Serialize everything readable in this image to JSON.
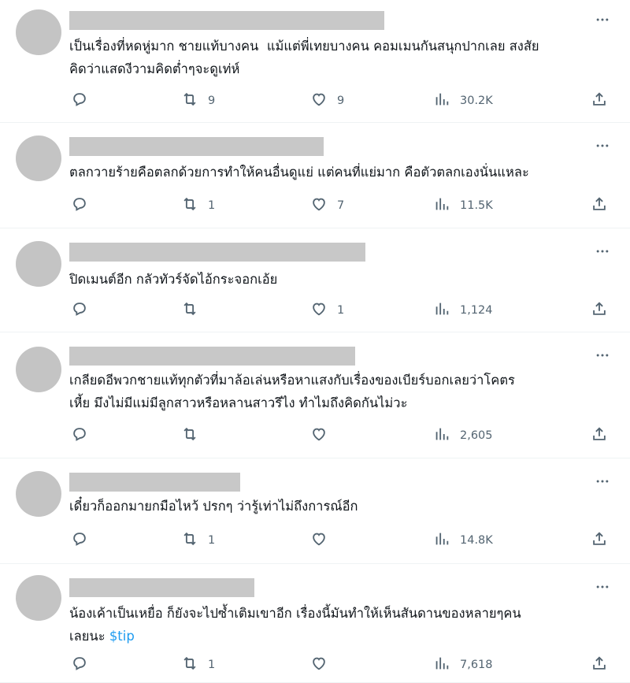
{
  "colors": {
    "text": "#0f1419",
    "muted": "#536471",
    "link": "#1d9bf0",
    "placeholder": "#c8c8c8"
  },
  "icons": {
    "reply": "reply-icon",
    "repost": "repost-icon",
    "like": "heart-icon",
    "views": "views-icon",
    "share": "share-icon",
    "more": "more-icon"
  },
  "replies": [
    {
      "text": "เป็นเรื่องที่หดหู่มาก ชายแท้บางคน  แม้แต่พี่เทยบางคน คอมเมนกันสนุกปากเลย สงสัย\nคิดว่าแสดงีวามคิดต่ำๆจะดูเท่ห์",
      "tag": "",
      "reposts": "9",
      "likes": "9",
      "views": "30.2K"
    },
    {
      "text": "ตลกวายร้ายคือตลกด้วยการทำให้คนอื่นดูแย่ แต่คนที่แย่มาก คือตัวตลกเองนั่นแหละ",
      "tag": "",
      "reposts": "1",
      "likes": "7",
      "views": "11.5K"
    },
    {
      "text": "ปิดเมนต์อีก กลัวทัวร์จัดไอ้กระจอกเอ้ย",
      "tag": "",
      "reposts": "",
      "likes": "1",
      "views": "1,124"
    },
    {
      "text": "เกลียดอีพวกชายแท้ทุกตัวที่มาล้อเล่นหรือหาแสงกับเรื่องของเบียร์บอกเลยว่าโคตร\nเหี้ย มึงไม่มีแม่มีลูกสาวหรือหลานสาวรึไง ทำไมถึงคิดกันไม่วะ",
      "tag": "",
      "reposts": "",
      "likes": "",
      "views": "2,605"
    },
    {
      "text": "เดี๋ยวก็ออกมายกมือไหว้ ปรกๆ ว่ารู้เท่าไม่ถึงการณ์อีก",
      "tag": "",
      "reposts": "1",
      "likes": "",
      "views": "14.8K"
    },
    {
      "text": "น้องเค้าเป็นเหยื่อ ก็ยังจะไปซ้ำเติมเขาอีก เรื่องนี้มันทำให้เห็นสันดานของหลายๆคน\nเลยนะ ",
      "tag": "$tip",
      "reposts": "1",
      "likes": "",
      "views": "7,618"
    }
  ]
}
